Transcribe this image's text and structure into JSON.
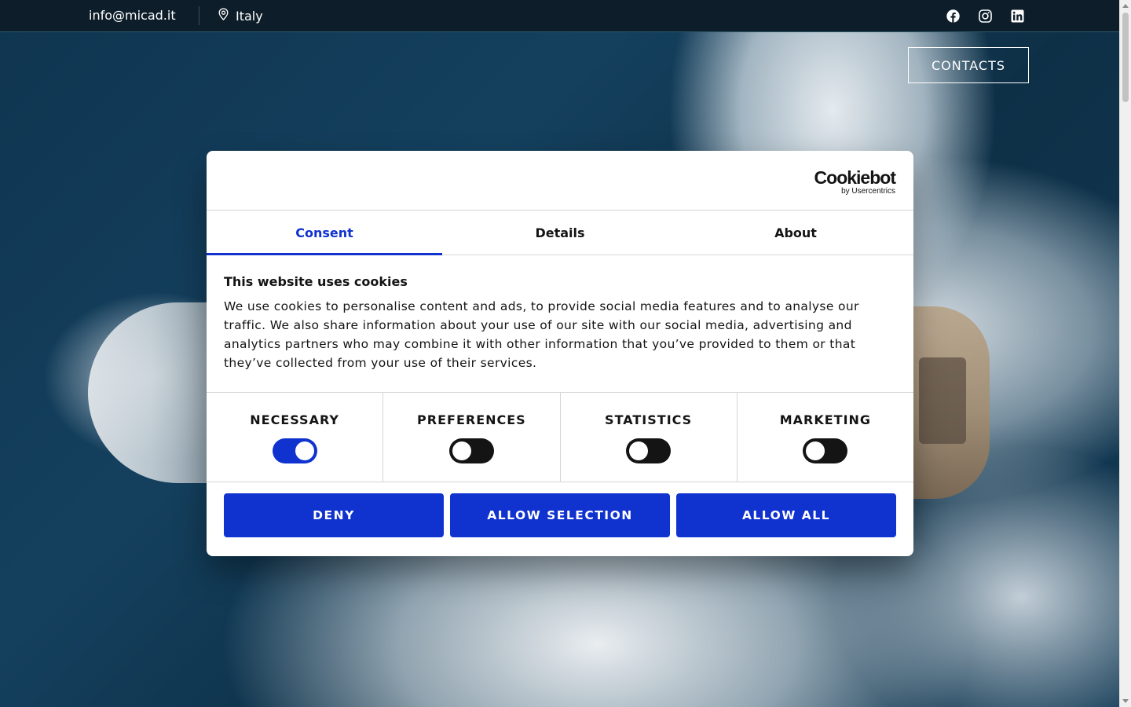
{
  "topbar": {
    "email": "info@micad.it",
    "location": "Italy",
    "location_icon": "map-pin-icon",
    "social_icons": [
      "facebook-icon",
      "instagram-icon",
      "linkedin-icon"
    ]
  },
  "header": {
    "contacts_label": "CONTACTS"
  },
  "cookie_dialog": {
    "brand_main": "Cookiebot",
    "brand_sub": "by Usercentrics",
    "tabs": [
      {
        "label": "Consent",
        "active": true
      },
      {
        "label": "Details",
        "active": false
      },
      {
        "label": "About",
        "active": false
      }
    ],
    "title": "This website uses cookies",
    "description": "We use cookies to personalise content and ads, to provide social media features and to analyse our traffic. We also share information about your use of our site with our social media, advertising and analytics partners who may combine it with other information that you’ve provided to them or that they’ve collected from your use of their services.",
    "toggles": [
      {
        "label": "NECESSARY",
        "on": true
      },
      {
        "label": "PREFERENCES",
        "on": false
      },
      {
        "label": "STATISTICS",
        "on": false
      },
      {
        "label": "MARKETING",
        "on": false
      }
    ],
    "buttons": {
      "deny": "DENY",
      "allow_selection": "ALLOW SELECTION",
      "allow_all": "ALLOW ALL"
    },
    "accent_color": "#1032cf"
  }
}
